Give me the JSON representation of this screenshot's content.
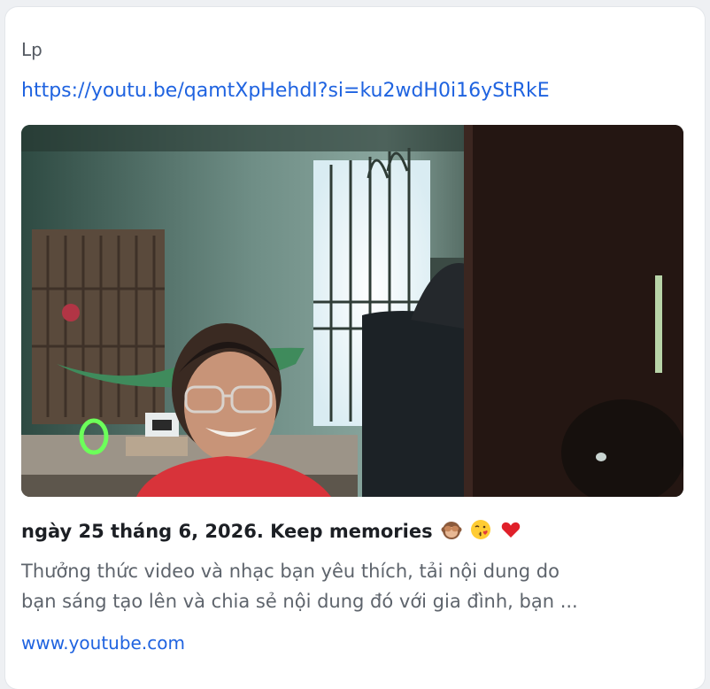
{
  "message": {
    "sender": "Lp",
    "link_text": "https://youtu.be/qamtXpHehdI?si=ku2wdH0i16yStRkE"
  },
  "preview": {
    "title": "ngày 25 tháng 6, 2026. Keep memories",
    "title_emojis": [
      "see-no-evil-monkey-icon",
      "kissing-face-icon",
      "red-heart-icon"
    ],
    "description_line1": "Thưởng thức video và nhạc bạn yêu thích, tải nội dung do",
    "description_line2": "bạn sáng tạo lên và chia sẻ nội dung đó với gia đình, bạn ...",
    "domain": "www.youtube.com",
    "thumbnail_icon": "video-thumbnail"
  },
  "colors": {
    "link": "#1f63e0",
    "title": "#1c1f24",
    "description": "#5e646c",
    "sender": "#555b63"
  }
}
